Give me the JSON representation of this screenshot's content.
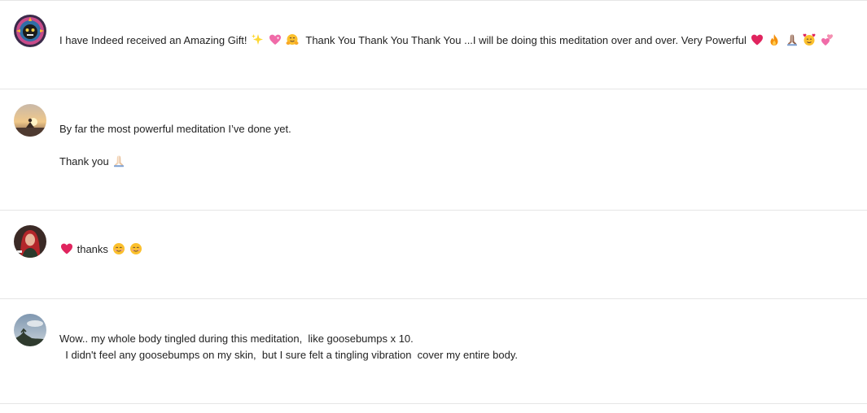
{
  "comments": [
    {
      "avatar": "mosaic-face-avatar",
      "segments": [
        "I have Indeed received an Amazing Gift! ",
        " ",
        " ",
        "  Thank You Thank You Thank You ...I will be doing this meditation over and over. Very Powerful "
      ],
      "emojis": [
        "sparkles-icon",
        "sparkling-heart-icon",
        "hugging-face-icon",
        "red-heart-icon",
        "fire-icon",
        "folded-hands-icon",
        "smiling-face-with-hearts-icon",
        "two-hearts-icon"
      ]
    },
    {
      "avatar": "sunset-meditation-avatar",
      "line1": "By far the most powerful meditation I’ve done yet.",
      "line2": "Thank you ",
      "emojis": [
        "folded-hands-icon"
      ]
    },
    {
      "avatar": "red-hair-portrait-avatar",
      "text": " thanks ",
      "emojis": [
        "red-heart-icon",
        "smiling-face-icon",
        "smiling-face-icon"
      ]
    },
    {
      "avatar": "sky-tree-avatar",
      "line1": "Wow.. my whole body tingled during this meditation,  like goosebumps x 10.",
      "line2": "  I didn't feel any goosebumps on my skin,  but I sure felt a tingling vibration  cover my entire body."
    }
  ],
  "colors": {
    "divider": "#e5e5e5",
    "text": "#222222",
    "heart": "#e0245e",
    "fire": "#f4900c",
    "pink": "#f06ba8"
  }
}
